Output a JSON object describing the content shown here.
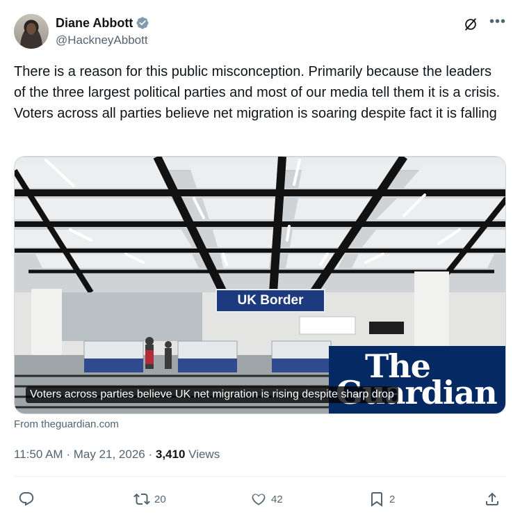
{
  "author": {
    "display_name": "Diane Abbott",
    "handle": "@HackneyAbbott",
    "verified": true,
    "verified_color": "#829aab"
  },
  "icons": {
    "avatar": "avatar",
    "verified": "verified-badge-icon",
    "grok": "grok-icon",
    "more": "more-icon",
    "reply": "reply-icon",
    "retweet": "retweet-icon",
    "like": "heart-icon",
    "bookmark": "bookmark-icon",
    "share": "share-icon"
  },
  "tweet": {
    "text": "There is a reason for this public misconception. Primarily because the leaders of the three largest political parties and most of our media tell them it is a crisis. Voters across all parties believe net migration is soaring despite fact it is falling"
  },
  "card": {
    "sign_text": "UK Border",
    "logo_line1": "The",
    "logo_line2": "Guardian",
    "caption": "Voters across parties believe UK net migration is rising despite sharp drop",
    "source": "From theguardian.com",
    "logo_color": "#052962"
  },
  "meta": {
    "time": "11:50 AM",
    "separator": "·",
    "date": "May 21, 2026",
    "views_count": "3,410",
    "views_label": "Views"
  },
  "actions": {
    "reply_count": "",
    "retweet_count": "20",
    "like_count": "42",
    "bookmark_count": "2"
  },
  "colors": {
    "text_primary": "#0f1419",
    "text_secondary": "#536471"
  }
}
